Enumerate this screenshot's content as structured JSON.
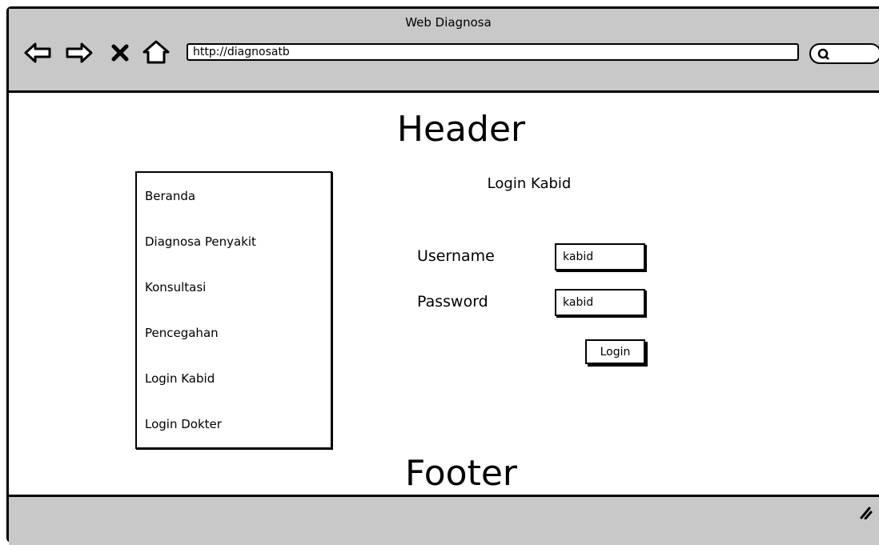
{
  "window": {
    "title": "Web Diagnosa"
  },
  "browser": {
    "url": "http://diagnosatb",
    "icons": [
      "back-arrow-icon",
      "forward-arrow-icon",
      "close-icon",
      "home-icon",
      "search-icon"
    ]
  },
  "header": {
    "text": "Header"
  },
  "sidebar": {
    "items": [
      {
        "label": "Beranda"
      },
      {
        "label": "Diagnosa Penyakit"
      },
      {
        "label": "Konsultasi"
      },
      {
        "label": "Pencegahan"
      },
      {
        "label": "Login Kabid"
      },
      {
        "label": "Login Dokter"
      }
    ]
  },
  "login_form": {
    "title": "Login Kabid",
    "username_label": "Username",
    "username_value": "kabid",
    "password_label": "Password",
    "password_value": "kabid",
    "submit_label": "Login"
  },
  "footer": {
    "text": "Footer"
  },
  "colors": {
    "chrome": "#c8c8c8",
    "border": "#000000",
    "background": "#ffffff"
  }
}
